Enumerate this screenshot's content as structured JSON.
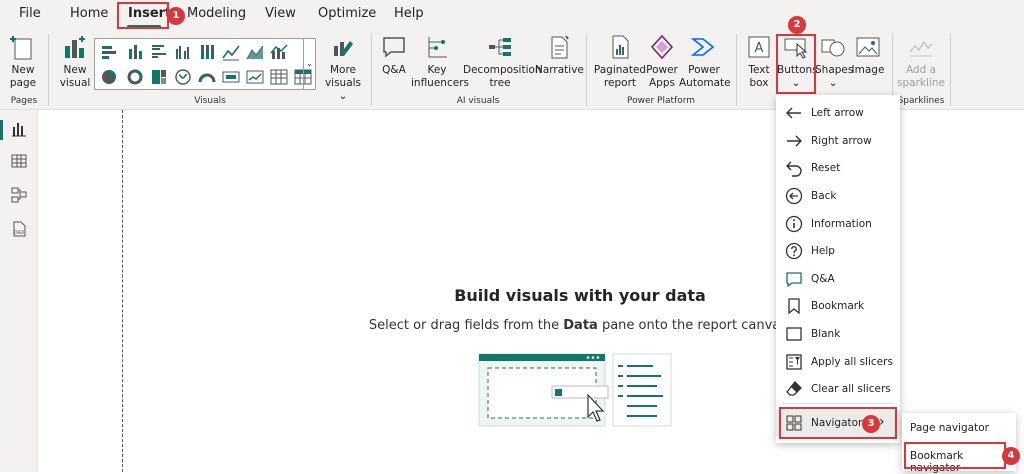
{
  "menu": {
    "items": [
      "File",
      "Home",
      "Insert",
      "Modeling",
      "View",
      "Optimize",
      "Help"
    ],
    "active": "Insert",
    "accent": "#117865"
  },
  "ribbon": {
    "pages": {
      "new_page_line1": "New",
      "new_page_line2": "page",
      "group": "Pages"
    },
    "visuals": {
      "new_visual_line1": "New",
      "new_visual_line2": "visual",
      "more_line1": "More",
      "more_line2": "visuals",
      "group": "Visuals"
    },
    "ai": {
      "qa": "Q&A",
      "key_line1": "Key",
      "key_line2": "influencers",
      "decomp_line1": "Decomposition",
      "decomp_line2": "tree",
      "narrative": "Narrative",
      "group": "AI visuals"
    },
    "power": {
      "paginated_line1": "Paginated",
      "paginated_line2": "report",
      "apps_line1": "Power",
      "apps_line2": "Apps",
      "automate_line1": "Power",
      "automate_line2": "Automate",
      "group": "Power Platform"
    },
    "elements": {
      "textbox_line1": "Text",
      "textbox_line2": "box",
      "buttons": "Buttons",
      "shapes": "Shapes",
      "image": "Image"
    },
    "sparklines": {
      "add_line1": "Add a",
      "add_line2": "sparkline",
      "group": "Sparklines"
    }
  },
  "canvas": {
    "title": "Build visuals with your data",
    "subtitle_pre": "Select or drag fields from the ",
    "subtitle_bold": "Data",
    "subtitle_post": " pane onto the report canvas."
  },
  "buttons_menu": {
    "items": [
      {
        "label": "Left arrow",
        "icon": "left-arrow-icon"
      },
      {
        "label": "Right arrow",
        "icon": "right-arrow-icon"
      },
      {
        "label": "Reset",
        "icon": "reset-icon"
      },
      {
        "label": "Back",
        "icon": "back-icon"
      },
      {
        "label": "Information",
        "icon": "information-icon"
      },
      {
        "label": "Help",
        "icon": "help-icon"
      },
      {
        "label": "Q&A",
        "icon": "qa-icon"
      },
      {
        "label": "Bookmark",
        "icon": "bookmark-icon"
      },
      {
        "label": "Blank",
        "icon": "blank-icon"
      },
      {
        "label": "Apply all slicers",
        "icon": "apply-slicers-icon"
      },
      {
        "label": "Clear all slicers",
        "icon": "clear-slicers-icon"
      },
      {
        "label": "Navigator",
        "icon": "navigator-icon"
      }
    ]
  },
  "navigator_submenu": {
    "items": [
      "Page navigator",
      "Bookmark navigator"
    ]
  },
  "steps": [
    "1",
    "2",
    "3",
    "4"
  ],
  "annotation_color": "#d9373c"
}
